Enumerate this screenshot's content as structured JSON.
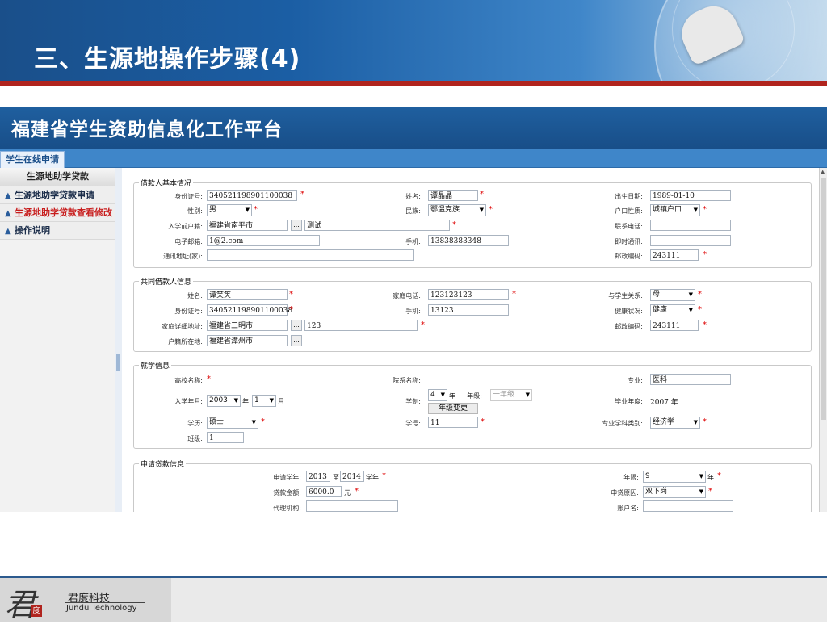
{
  "slide": {
    "title": "三、生源地操作步骤(4)"
  },
  "app": {
    "banner_title": "福建省学生资助信息化工作平台",
    "active_tab": "学生在线申请"
  },
  "sidebar": {
    "header": "生源地助学贷款",
    "items": [
      {
        "label": "生源地助学贷款申请"
      },
      {
        "label": "生源地助学贷款查看修改"
      },
      {
        "label": "操作说明"
      }
    ]
  },
  "borrower": {
    "legend": "借款人基本情况",
    "id_label": "身份证号:",
    "id_value": "340521198901100038",
    "name_label": "姓名:",
    "name_value": "谭晶晶",
    "birth_label": "出生日期:",
    "birth_value": "1989-01-10",
    "gender_label": "性别:",
    "gender_value": "男",
    "ethnic_label": "民族:",
    "ethnic_value": "鄂温克族",
    "hukou_type_label": "户口性质:",
    "hukou_type_value": "城镇户口",
    "pre_hukou_label": "入学前户籍:",
    "pre_hukou_value": "福建省南平市",
    "pre_hukou_detail": "测试",
    "phone_label": "联系电话:",
    "phone_value": "",
    "email_label": "电子邮箱:",
    "email_value": "1@2.com",
    "mobile_label": "手机:",
    "mobile_value": "13838383348",
    "im_label": "即时通讯:",
    "im_value": "",
    "address_label": "通讯地址(家):",
    "address_value": "",
    "zip_label": "邮政编码:",
    "zip_value": "243111"
  },
  "coborrower": {
    "legend": "共同借款人信息",
    "name_label": "姓名:",
    "name_value": "谭笑笑",
    "home_phone_label": "家庭电话:",
    "home_phone_value": "123123123",
    "relation_label": "与学生关系:",
    "relation_value": "母",
    "id_label": "身份证号:",
    "id_value": "340521198901100038",
    "mobile_label": "手机:",
    "mobile_value": "13123",
    "health_label": "健康状况:",
    "health_value": "健康",
    "address_label": "家庭详细地址:",
    "address_value": "福建省三明市",
    "address_detail": "123",
    "zip_label": "邮政编码:",
    "zip_value": "243111",
    "hukou_label": "户籍所在地:",
    "hukou_value": "福建省漳州市"
  },
  "study": {
    "legend": "就学信息",
    "school_label": "高校名称:",
    "dept_label": "院系名称:",
    "major_label": "专业:",
    "major_value": "医科",
    "enroll_label": "入学年月:",
    "enroll_year": "2003",
    "enroll_year_unit": "年",
    "enroll_month": "1",
    "enroll_month_unit": "月",
    "length_label": "学制:",
    "length_value": "4",
    "length_unit": "年",
    "grade_label": "年级:",
    "grade_value": "一年级",
    "grade_change_button": "年级变更",
    "grad_label": "毕业年度:",
    "grad_value": "2007 年",
    "degree_label": "学历:",
    "degree_value": "硕士",
    "student_no_label": "学号:",
    "student_no_value": "11",
    "category_label": "专业学科类别:",
    "category_value": "经济学",
    "class_label": "班级:",
    "class_value": "1"
  },
  "loan": {
    "legend": "申请贷款信息",
    "year_label": "申请学年:",
    "year_from": "2013",
    "year_to_word": "至",
    "year_to": "2014",
    "year_suffix": "学年",
    "term_label": "年限:",
    "term_value": "9",
    "term_unit": "年",
    "amount_label": "贷款金额:",
    "amount_value": "6000.0",
    "amount_unit": "元",
    "reason_label": "申贷原因:",
    "reason_value": "双下岗",
    "agency_label": "代理机构:",
    "agency_value": "",
    "account_label": "账户名:",
    "account_value": ""
  },
  "footer": {
    "company_cn": "君度科技",
    "company_en": "Jundu Technology",
    "logo_glyph": "君",
    "seal": "度"
  }
}
